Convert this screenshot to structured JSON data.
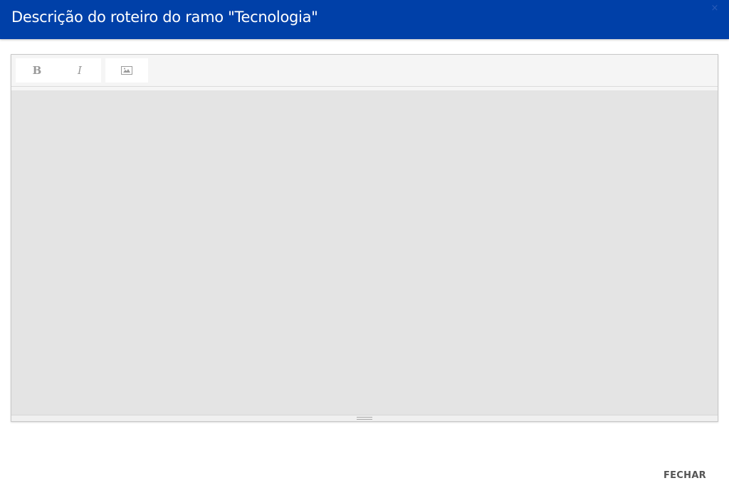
{
  "header": {
    "title": "Descrição do roteiro do ramo \"Tecnologia\"",
    "close_glyph": "×",
    "background": "#0040a8"
  },
  "editor": {
    "toolbar": {
      "bold_label": "B",
      "italic_label": "I",
      "image_icon": "image-icon"
    },
    "content_text": ""
  },
  "footer": {
    "close_label": "FECHAR"
  }
}
